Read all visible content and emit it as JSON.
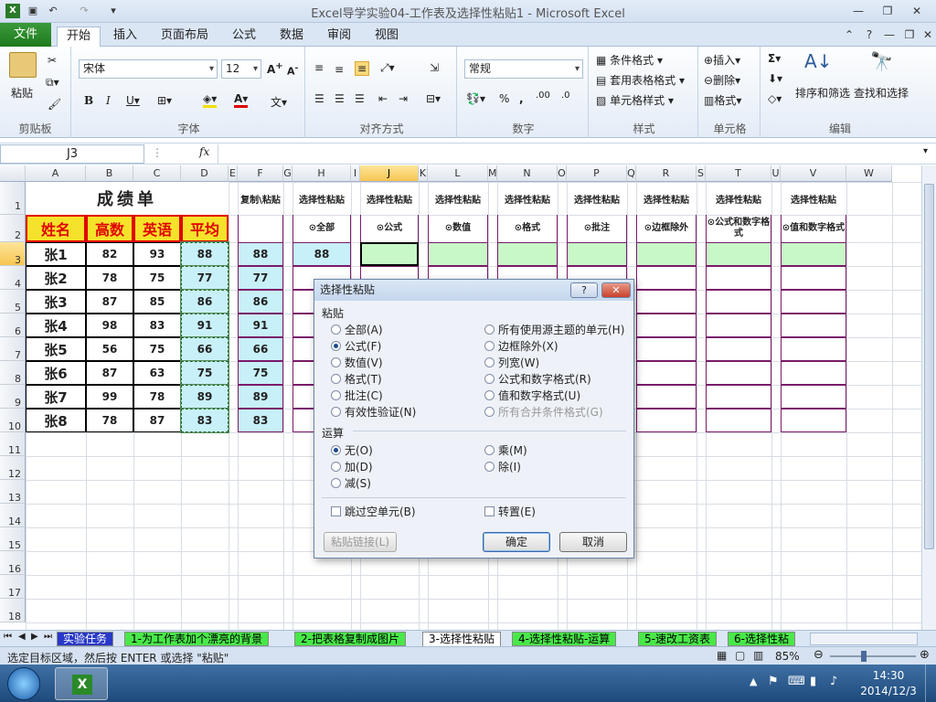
{
  "window": {
    "title": "Excel导学实验04-工作表及选择性粘贴1 - Microsoft Excel"
  },
  "tabs": [
    "文件",
    "开始",
    "插入",
    "页面布局",
    "公式",
    "数据",
    "审阅",
    "视图"
  ],
  "ribbon": {
    "clipboard": {
      "label": "剪贴板",
      "paste": "粘贴"
    },
    "font": {
      "label": "字体",
      "name": "宋体",
      "size": "12"
    },
    "alignment": {
      "label": "对齐方式"
    },
    "number": {
      "label": "数字",
      "format": "常规"
    },
    "styles": {
      "label": "样式",
      "cond": "条件格式",
      "table": "套用表格格式",
      "cell": "单元格样式"
    },
    "cells": {
      "label": "单元格",
      "insert": "插入",
      "delete": "删除",
      "format": "格式"
    },
    "editing": {
      "label": "编辑",
      "sort": "排序和筛选",
      "find": "查找和选择"
    }
  },
  "formula": {
    "namebox": "J3",
    "fx": "fx",
    "content": ""
  },
  "columns": [
    "A",
    "B",
    "C",
    "D",
    "E",
    "F",
    "G",
    "H",
    "I",
    "J",
    "K",
    "L",
    "M",
    "N",
    "O",
    "P",
    "Q",
    "R",
    "S",
    "T",
    "U",
    "V",
    "W"
  ],
  "rows": [
    "1",
    "2",
    "3",
    "4",
    "5",
    "6",
    "7",
    "8",
    "9",
    "10",
    "11",
    "12",
    "13",
    "14",
    "15",
    "16",
    "17",
    "18"
  ],
  "sheet": {
    "title": "成绩单",
    "headers": [
      "姓名",
      "高数",
      "英语",
      "平均"
    ],
    "students": [
      {
        "name": "张1",
        "math": "82",
        "eng": "93",
        "avg": "88"
      },
      {
        "name": "张2",
        "math": "78",
        "eng": "75",
        "avg": "77"
      },
      {
        "name": "张3",
        "math": "87",
        "eng": "85",
        "avg": "86"
      },
      {
        "name": "张4",
        "math": "98",
        "eng": "83",
        "avg": "91"
      },
      {
        "name": "张5",
        "math": "56",
        "eng": "75",
        "avg": "66"
      },
      {
        "name": "张6",
        "math": "87",
        "eng": "63",
        "avg": "75"
      },
      {
        "name": "张7",
        "math": "99",
        "eng": "78",
        "avg": "89"
      },
      {
        "name": "张8",
        "math": "78",
        "eng": "87",
        "avg": "83"
      }
    ],
    "copy_header": "复制\\粘贴",
    "ps_header": "选择性粘贴",
    "ps_options": [
      "⊙全部",
      "⊙公式",
      "⊙数值",
      "⊙格式",
      "⊙批注",
      "⊙边框除外",
      "⊙公式和数字格式",
      "⊙值和数字格式"
    ],
    "h3": "88"
  },
  "dialog": {
    "title": "选择性粘贴",
    "help": "?",
    "close": "✕",
    "paste_label": "粘贴",
    "paste_left": [
      "全部(A)",
      "公式(F)",
      "数值(V)",
      "格式(T)",
      "批注(C)",
      "有效性验证(N)"
    ],
    "paste_right": [
      "所有使用源主题的单元(H)",
      "边框除外(X)",
      "列宽(W)",
      "公式和数字格式(R)",
      "值和数字格式(U)",
      "所有合并条件格式(G)"
    ],
    "op_label": "运算",
    "op_left": [
      "无(O)",
      "加(D)",
      "减(S)"
    ],
    "op_right": [
      "乘(M)",
      "除(I)"
    ],
    "skip_blanks": "跳过空单元(B)",
    "transpose": "转置(E)",
    "paste_link": "粘贴链接(L)",
    "ok": "确定",
    "cancel": "取消"
  },
  "sheet_tabs": [
    "实验任务",
    "1-为工作表加个漂亮的背景",
    "2-把表格复制成图片",
    "3-选择性粘贴",
    "4-选择性粘贴-运算",
    "5-速改工资表",
    "6-选择性粘"
  ],
  "status": {
    "message": "选定目标区域，然后按 ENTER 或选择 \"粘贴\"",
    "zoom": "85%"
  },
  "taskbar": {
    "time": "14:30",
    "date": "2014/12/3"
  }
}
